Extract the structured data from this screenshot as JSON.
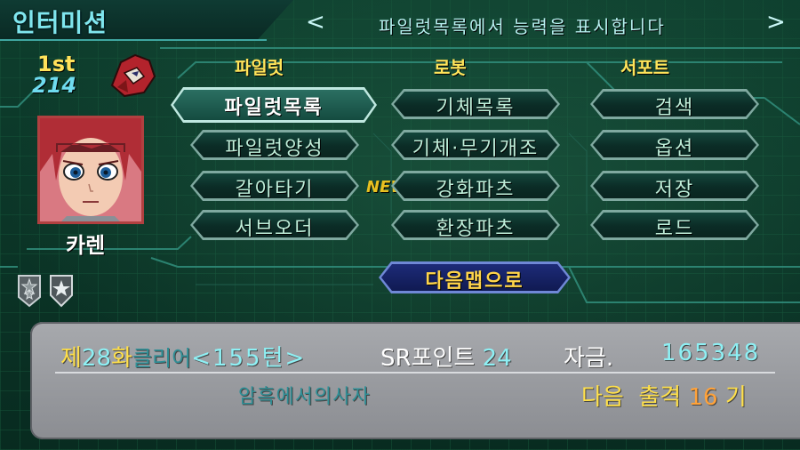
{
  "header": {
    "title": "인터미션",
    "help_text": "파일럿목록에서  능력을  표시합니다",
    "arrow_left": "<",
    "arrow_right": ">"
  },
  "pilot_panel": {
    "rank": "1st",
    "score": "214",
    "name": "카렌",
    "badges": [
      "star-badge-icon",
      "shield-star-badge-icon"
    ]
  },
  "columns": {
    "pilot": {
      "header": "파일럿",
      "items": [
        {
          "label": "파일럿목록",
          "selected": true
        },
        {
          "label": "파일럿양성",
          "selected": false
        },
        {
          "label": "갈아타기",
          "selected": false
        },
        {
          "label": "서브오더",
          "selected": false
        }
      ]
    },
    "robot": {
      "header": "로봇",
      "items": [
        {
          "label": "기체목록"
        },
        {
          "label": "기체·무기개조"
        },
        {
          "label": "강화파츠",
          "tag": "NEW!"
        },
        {
          "label": "환장파츠"
        }
      ]
    },
    "support": {
      "header": "서포트",
      "items": [
        {
          "label": "검색"
        },
        {
          "label": "옵션"
        },
        {
          "label": "저장"
        },
        {
          "label": "로드"
        }
      ]
    }
  },
  "next_map_button": {
    "label": "다음맵으로"
  },
  "status": {
    "chapter_prefix": "제",
    "chapter_number": "28",
    "chapter_suffix": "화",
    "clear_label": "클리어",
    "clear_turns": "<155턴>",
    "sr_label": "SR포인트",
    "sr_value": "24",
    "funds_label": "자금.",
    "funds_value": "165348",
    "stage_name": "암흑에서의사자",
    "sortie_label": "다음  출격",
    "sortie_count": "16",
    "sortie_unit": "기"
  },
  "colors": {
    "header_title": "#7fe6ee",
    "gold": "#ffe04a",
    "cyan": "#8ef0f4",
    "next_button": "#101a52",
    "panel_grey": "#9a9ca1"
  }
}
